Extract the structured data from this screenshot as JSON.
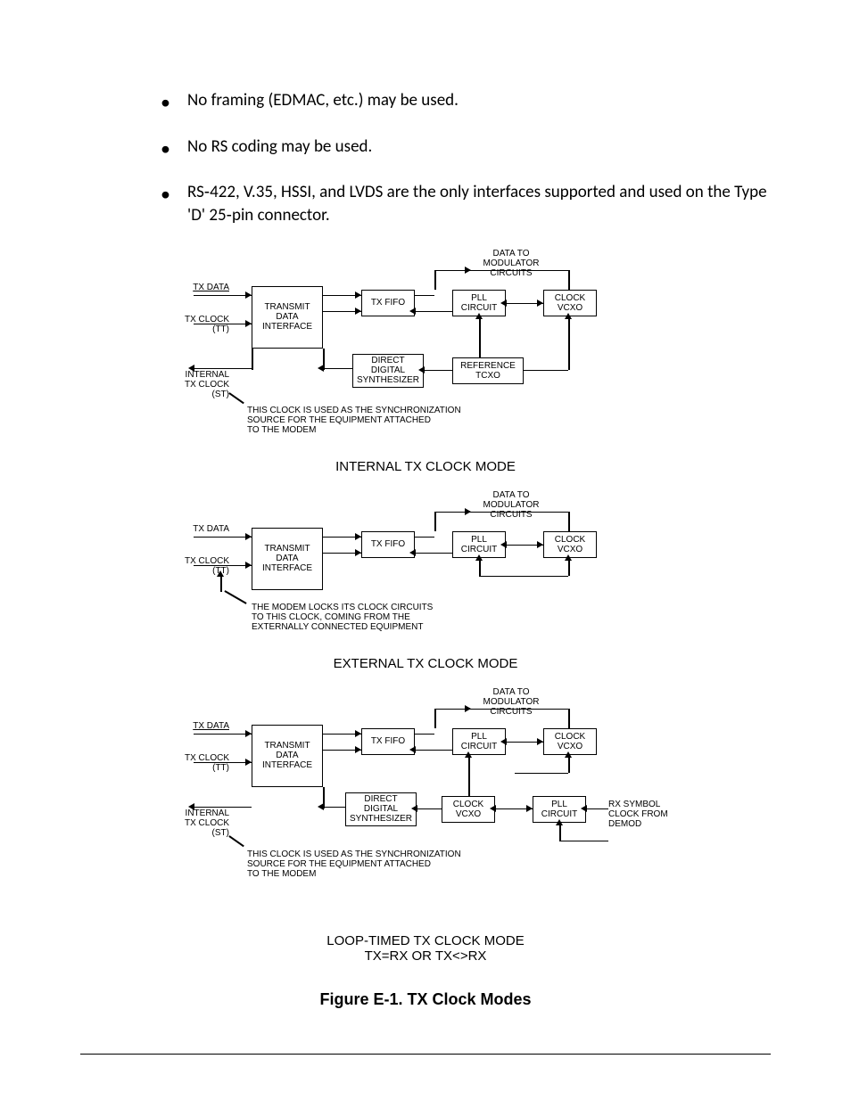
{
  "bullets": [
    "No framing (EDMAC, etc.) may be used.",
    "No RS coding may be used.",
    "RS‑422, V.35, HSSI, and LVDS are the only interfaces supported and used on the Type 'D' 25‑pin connector."
  ],
  "labels": {
    "tx_data": "TX DATA",
    "tx_clock_tt": "TX CLOCK\n(TT)",
    "internal_txclock_st": "INTERNAL\nTX CLOCK\n(ST)",
    "data_to_mod": "DATA TO\nMODULATOR\nCIRCUITS",
    "rx_symbol": "RX SYMBOL\nCLOCK FROM\nDEMOD"
  },
  "blocks": {
    "tdi": "TRANSMIT\nDATA\nINTERFACE",
    "txfifo": "TX\nFIFO",
    "pll": "PLL\nCIRCUIT",
    "vcxo": "CLOCK\nVCXO",
    "dds": "DIRECT\nDIGITAL\nSYNTHESIZER",
    "ref_tcxo": "REFERENCE\nTCXO"
  },
  "notes": {
    "sync_source": "THIS CLOCK IS USED AS THE SYNCHRONIZATION\nSOURCE FOR THE EQUIPMENT ATTACHED\nTO THE MODEM",
    "modem_locks": "THE MODEM LOCKS ITS CLOCK CIRCUITS\nTO THIS CLOCK, COMING FROM THE\nEXTERNALLY CONNECTED EQUIPMENT"
  },
  "mode_titles": {
    "internal": "INTERNAL TX CLOCK MODE",
    "external": "EXTERNAL TX CLOCK MODE",
    "loop": "LOOP-TIMED TX CLOCK MODE\nTX=RX  OR  TX<>RX"
  },
  "figure_caption": "Figure E-1. TX Clock Modes"
}
